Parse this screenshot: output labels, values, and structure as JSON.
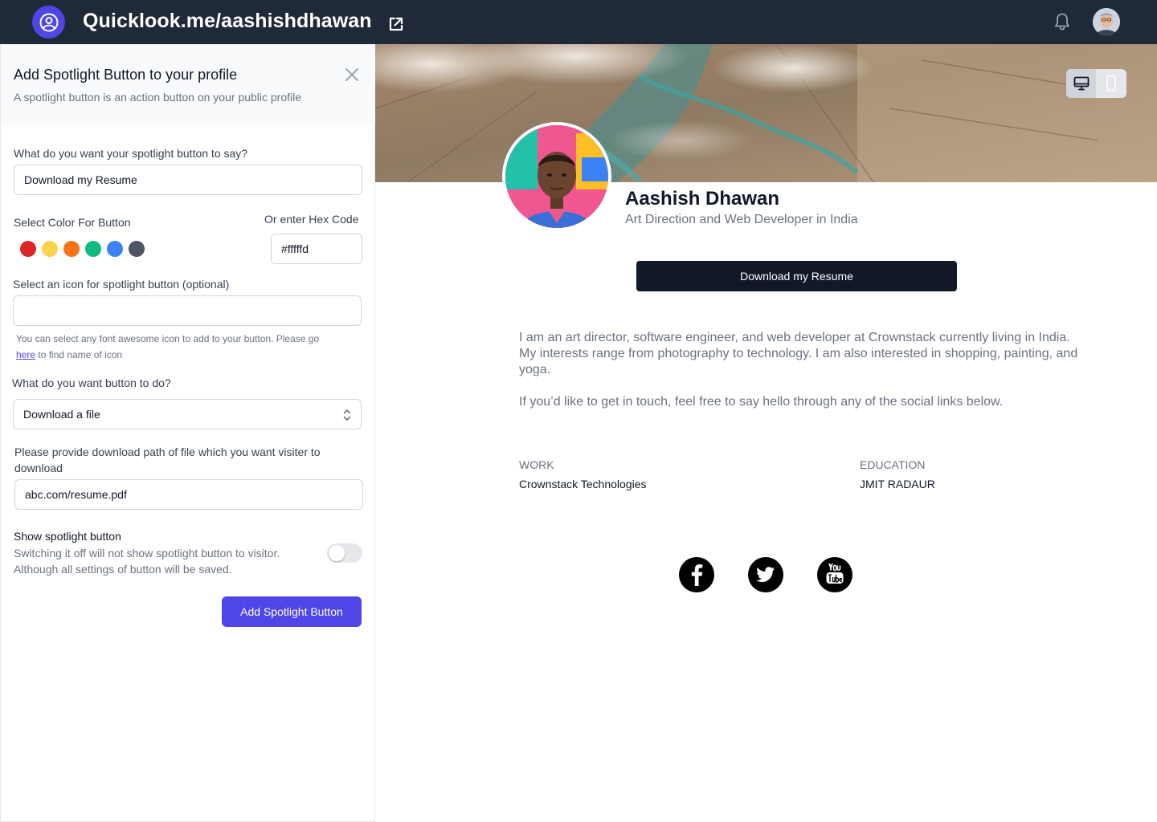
{
  "topbar": {
    "site_title": "Quicklook.me/aashishdhawan",
    "icons": [
      "user-circle-icon",
      "external-link-icon",
      "bell-icon",
      "avatar"
    ]
  },
  "panel": {
    "title": "Add Spotlight Button to your profile",
    "subtitle": "A spotlight button is an action button on your public profile",
    "button_text_label": "What do you want your spotlight button to say?",
    "button_text_value": "Download my Resume",
    "color_label": "Select Color For Button",
    "hex_label": "Or enter Hex Code",
    "hex_value": "#fffffd",
    "colors": [
      "#dc2626",
      "#fcd34d",
      "#f97316",
      "#10b981",
      "#3b82f6",
      "#4b5563"
    ],
    "icon_label": "Select an icon for spotlight button (optional)",
    "icon_value": "",
    "hint_before": "You can select any font awesome icon to add to your button.  Please go",
    "hint_link": "here",
    "hint_after": " to find name of icon",
    "action_label": "What do you want button to do?",
    "action_value": "Download a file",
    "path_label": "Please provide download path of file which you want visiter to download",
    "path_value": "abc.com/resume.pdf",
    "toggle_title": "Show spotlight button",
    "toggle_desc": "Switching it off will not show spotlight button to visitor. Although all settings of button will be saved.",
    "toggle_on": false,
    "submit_label": "Add Spotlight Button"
  },
  "preview": {
    "name": "Aashish Dhawan",
    "role": "Art Direction and Web Developer in India",
    "spotlight_label": "Download my Resume",
    "bio_1": "I am an art director, software engineer, and web developer at Crownstack currently living in India. My interests range from photography to technology. I am also interested in shopping, painting, and yoga.",
    "bio_2": "If you’d like to get in touch, feel free to say hello through any of the social links below.",
    "work_label": "WORK",
    "work_value": "Crownstack Technologies",
    "education_label": "EDUCATION",
    "education_value": "JMIT RADAUR",
    "social": [
      "facebook-icon",
      "twitter-icon",
      "youtube-icon"
    ],
    "view_modes": [
      "desktop-icon",
      "mobile-icon"
    ]
  }
}
